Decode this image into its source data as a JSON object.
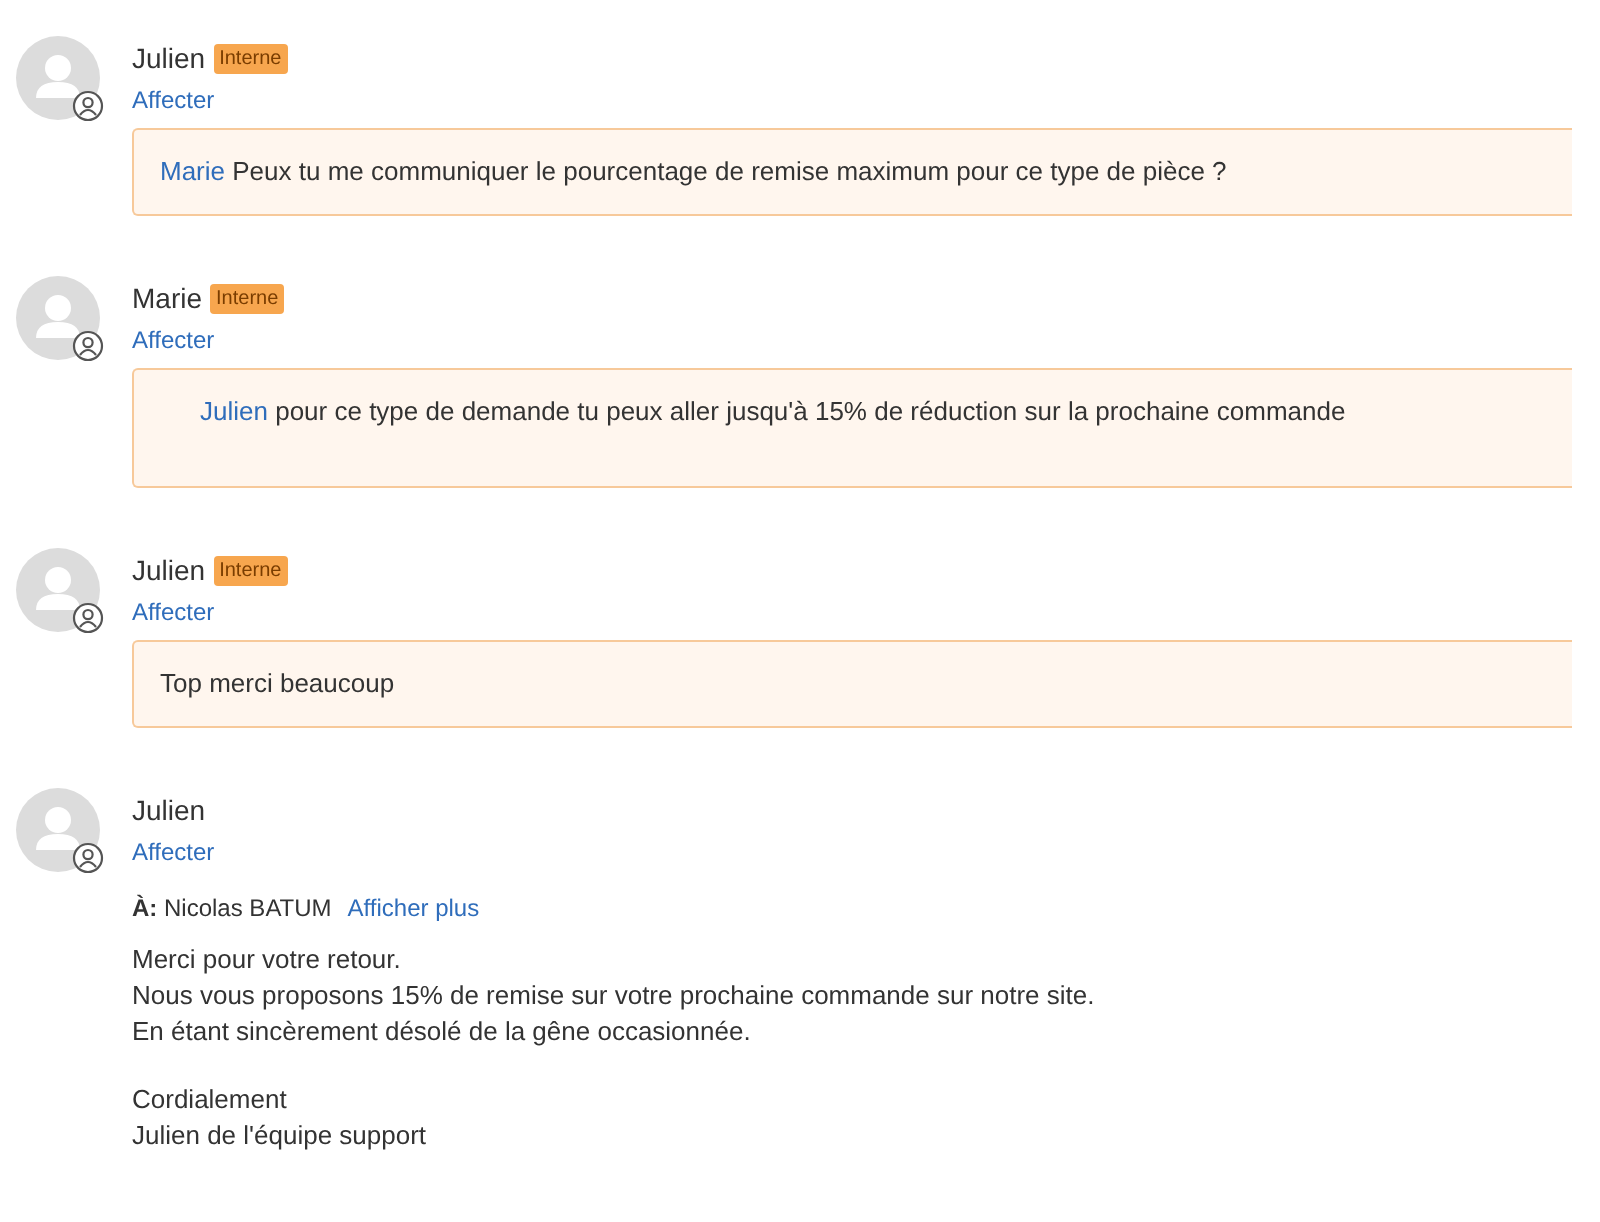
{
  "posts": [
    {
      "kind": "note",
      "author": "Julien",
      "badge": "Interne",
      "action": "Affecter",
      "mention": "Marie",
      "text": "Peux tu me communiquer le pourcentage de remise maximum pour ce type de pièce ?"
    },
    {
      "kind": "note",
      "author": "Marie",
      "badge": "Interne",
      "action": "Affecter",
      "mention": "Julien",
      "text": "pour ce type de demande tu peux aller jusqu'à 15% de réduction sur la prochaine commande"
    },
    {
      "kind": "note",
      "author": "Julien",
      "badge": "Interne",
      "action": "Affecter",
      "text": "Top merci beaucoup"
    },
    {
      "kind": "email",
      "author": "Julien",
      "action": "Affecter",
      "to_label": "À:",
      "to": "Nicolas BATUM",
      "more": "Afficher plus",
      "paragraphs": [
        [
          "Merci pour votre retour.",
          "Nous vous proposons 15% de remise sur votre prochaine commande sur notre site.",
          "En étant sincèrement désolé de la gêne occasionnée."
        ],
        [
          "Cordialement",
          "Julien de l'équipe support"
        ]
      ]
    }
  ]
}
